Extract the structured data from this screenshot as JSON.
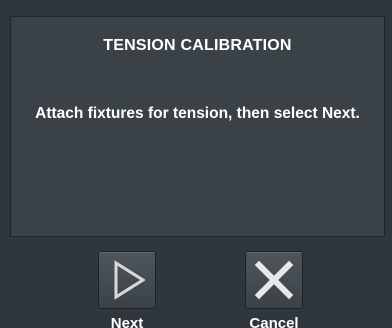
{
  "dialog": {
    "title": "TENSION CALIBRATION",
    "message": "Attach fixtures for tension, then select Next."
  },
  "actions": {
    "next": {
      "label": "Next",
      "icon": "play-triangle-icon"
    },
    "cancel": {
      "label": "Cancel",
      "icon": "x-close-icon"
    }
  },
  "colors": {
    "background": "#2f373d",
    "panel": "#3a4147",
    "text": "#ffffff"
  }
}
